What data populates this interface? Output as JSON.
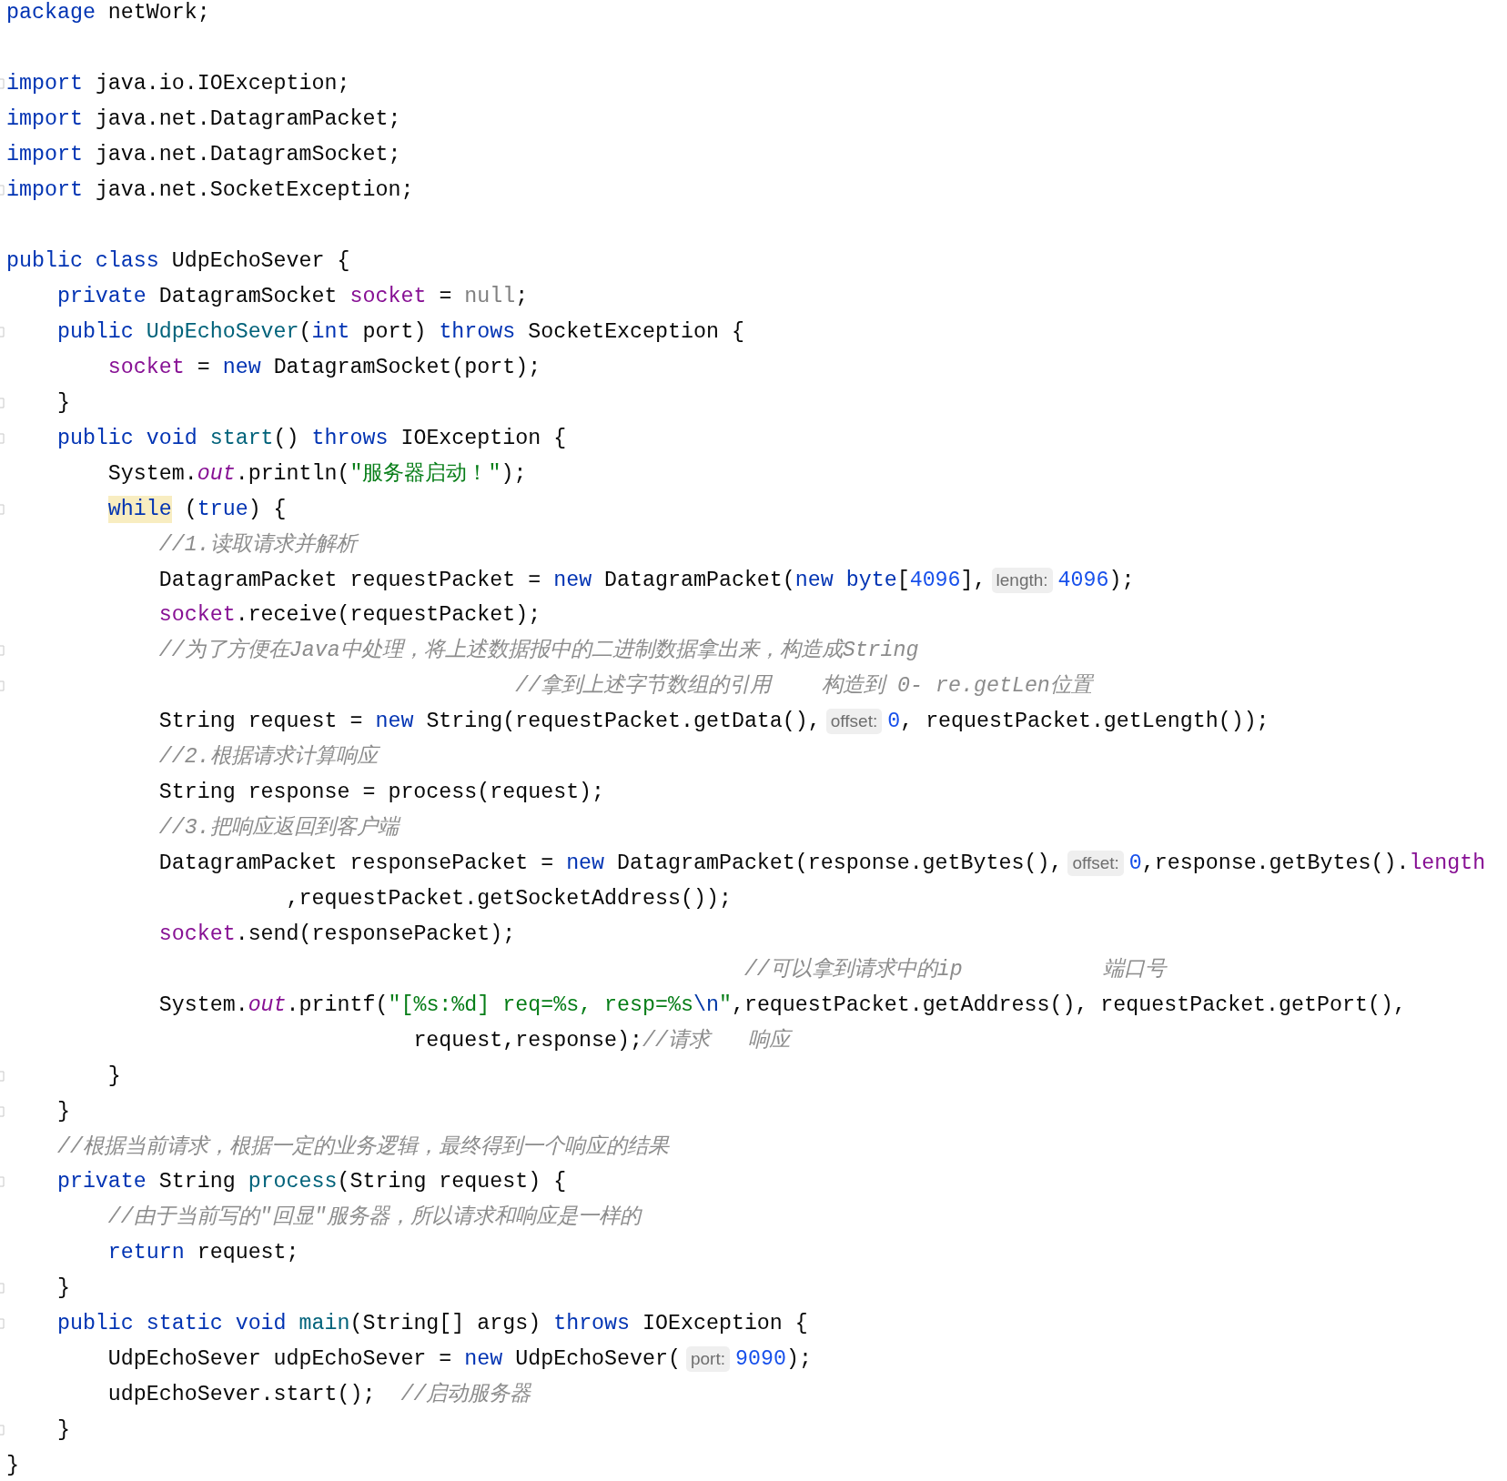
{
  "editor": {
    "lines": [
      {
        "tokens": [
          {
            "kind": "kw",
            "text": "package"
          },
          {
            "kind": "plain",
            "text": " netWork;"
          }
        ]
      },
      {
        "blank_line_before": true,
        "fold": true,
        "tokens": [
          {
            "kind": "kw",
            "text": "import"
          },
          {
            "kind": "plain",
            "text": " java.io.IOException;"
          }
        ]
      },
      {
        "tokens": [
          {
            "kind": "kw",
            "text": "import"
          },
          {
            "kind": "plain",
            "text": " java.net.DatagramPacket;"
          }
        ]
      },
      {
        "tokens": [
          {
            "kind": "kw",
            "text": "import"
          },
          {
            "kind": "plain",
            "text": " java.net.DatagramSocket;"
          }
        ]
      },
      {
        "fold": true,
        "tokens": [
          {
            "kind": "kw",
            "text": "import"
          },
          {
            "kind": "plain",
            "text": " java.net.SocketException;"
          }
        ]
      },
      {
        "blank_line_before": true,
        "tokens": [
          {
            "kind": "kw",
            "text": "public class"
          },
          {
            "kind": "plain",
            "text": " UdpEchoSever {"
          }
        ]
      },
      {
        "tokens": [
          {
            "kind": "kw",
            "text": "    private"
          },
          {
            "kind": "plain",
            "text": " DatagramSocket "
          },
          {
            "kind": "field",
            "text": "socket"
          },
          {
            "kind": "plain",
            "text": " = "
          },
          {
            "kind": "null",
            "text": "null"
          },
          {
            "kind": "plain",
            "text": ";"
          }
        ]
      },
      {
        "fold": true,
        "tokens": [
          {
            "kind": "kw",
            "text": "    public "
          },
          {
            "kind": "decl",
            "text": "UdpEchoSever"
          },
          {
            "kind": "plain",
            "text": "("
          },
          {
            "kind": "kw",
            "text": "int"
          },
          {
            "kind": "plain",
            "text": " port) "
          },
          {
            "kind": "kw",
            "text": "throws"
          },
          {
            "kind": "plain",
            "text": " SocketException {"
          }
        ]
      },
      {
        "tokens": [
          {
            "kind": "field",
            "text": "        socket"
          },
          {
            "kind": "plain",
            "text": " = "
          },
          {
            "kind": "kw",
            "text": "new"
          },
          {
            "kind": "plain",
            "text": " DatagramSocket(port);"
          }
        ]
      },
      {
        "fold": true,
        "tokens": [
          {
            "kind": "plain",
            "text": "    }"
          }
        ]
      },
      {
        "fold": true,
        "tokens": [
          {
            "kind": "kw",
            "text": "    public void "
          },
          {
            "kind": "decl",
            "text": "start"
          },
          {
            "kind": "plain",
            "text": "() "
          },
          {
            "kind": "kw",
            "text": "throws"
          },
          {
            "kind": "plain",
            "text": " IOException {"
          }
        ]
      },
      {
        "tokens": [
          {
            "kind": "plain",
            "text": "        System."
          },
          {
            "kind": "static",
            "text": "out"
          },
          {
            "kind": "plain",
            "text": ".println("
          },
          {
            "kind": "str",
            "text": "\"服务器启动！\""
          },
          {
            "kind": "plain",
            "text": ");"
          }
        ]
      },
      {
        "fold": true,
        "tokens": [
          {
            "kind": "highlight",
            "text": "        while"
          },
          {
            "kind": "plain",
            "text": " ("
          },
          {
            "kind": "kw",
            "text": "true"
          },
          {
            "kind": "plain",
            "text": ") {"
          }
        ]
      },
      {
        "tokens": [
          {
            "kind": "comment",
            "text": "            //1.读取请求并解析"
          }
        ]
      },
      {
        "tokens": [
          {
            "kind": "plain",
            "text": "            DatagramPacket requestPacket = "
          },
          {
            "kind": "kw",
            "text": "new"
          },
          {
            "kind": "plain",
            "text": " DatagramPacket("
          },
          {
            "kind": "kw",
            "text": "new byte"
          },
          {
            "kind": "plain",
            "text": "["
          },
          {
            "kind": "num",
            "text": "4096"
          },
          {
            "kind": "plain",
            "text": "],"
          },
          {
            "kind": "hint",
            "text": "length:"
          },
          {
            "kind": "num",
            "text": "4096"
          },
          {
            "kind": "plain",
            "text": ");"
          }
        ]
      },
      {
        "tokens": [
          {
            "kind": "field",
            "text": "            socket"
          },
          {
            "kind": "plain",
            "text": ".receive(requestPacket);"
          }
        ]
      },
      {
        "fold": true,
        "tokens": [
          {
            "kind": "comment",
            "text": "            //为了方便在Java中处理，将上述数据报中的二进制数据拿出来，构造成String"
          }
        ]
      },
      {
        "fold": true,
        "tokens": [
          {
            "kind": "comment",
            "text": "                                        //拿到上述字节数组的引用    构造到 0- re.getLen位置"
          }
        ]
      },
      {
        "tokens": [
          {
            "kind": "plain",
            "text": "            String request = "
          },
          {
            "kind": "kw",
            "text": "new"
          },
          {
            "kind": "plain",
            "text": " String(requestPacket.getData(),"
          },
          {
            "kind": "hint",
            "text": "offset:"
          },
          {
            "kind": "num",
            "text": "0"
          },
          {
            "kind": "plain",
            "text": ", requestPacket.getLength());"
          }
        ]
      },
      {
        "tokens": [
          {
            "kind": "comment",
            "text": "            //2.根据请求计算响应"
          }
        ]
      },
      {
        "tokens": [
          {
            "kind": "plain",
            "text": "            String response = process(request);"
          }
        ]
      },
      {
        "tokens": [
          {
            "kind": "comment",
            "text": "            //3.把响应返回到客户端"
          }
        ]
      },
      {
        "tokens": [
          {
            "kind": "plain",
            "text": "            DatagramPacket responsePacket = "
          },
          {
            "kind": "kw",
            "text": "new"
          },
          {
            "kind": "plain",
            "text": " DatagramPacket(response.getBytes(),"
          },
          {
            "kind": "hint",
            "text": "offset:"
          },
          {
            "kind": "num",
            "text": "0"
          },
          {
            "kind": "plain",
            "text": ",response.getBytes()."
          },
          {
            "kind": "field",
            "text": "length"
          }
        ]
      },
      {
        "tokens": [
          {
            "kind": "plain",
            "text": "                      ,requestPacket.getSocketAddress());"
          }
        ]
      },
      {
        "tokens": [
          {
            "kind": "field",
            "text": "            socket"
          },
          {
            "kind": "plain",
            "text": ".send(responsePacket);"
          }
        ]
      },
      {
        "tokens": [
          {
            "kind": "comment",
            "text": "                                                          //可以拿到请求中的ip           端口号"
          }
        ]
      },
      {
        "tokens": [
          {
            "kind": "plain",
            "text": "            System."
          },
          {
            "kind": "static",
            "text": "out"
          },
          {
            "kind": "plain",
            "text": ".printf("
          },
          {
            "kind": "str",
            "text": "\"[%s:%d] req=%s, resp=%s"
          },
          {
            "kind": "escape",
            "text": "\\n"
          },
          {
            "kind": "str",
            "text": "\""
          },
          {
            "kind": "plain",
            "text": ",requestPacket.getAddress(), requestPacket.getPort(),"
          }
        ]
      },
      {
        "tokens": [
          {
            "kind": "plain",
            "text": "                                request,response);"
          },
          {
            "kind": "comment",
            "text": "//请求   响应"
          }
        ]
      },
      {
        "fold": true,
        "tokens": [
          {
            "kind": "plain",
            "text": "        }"
          }
        ]
      },
      {
        "fold": true,
        "tokens": [
          {
            "kind": "plain",
            "text": "    }"
          }
        ]
      },
      {
        "tokens": [
          {
            "kind": "comment",
            "text": "    //根据当前请求，根据一定的业务逻辑，最终得到一个响应的结果"
          }
        ]
      },
      {
        "fold": true,
        "tokens": [
          {
            "kind": "kw",
            "text": "    private"
          },
          {
            "kind": "plain",
            "text": " String "
          },
          {
            "kind": "decl",
            "text": "process"
          },
          {
            "kind": "plain",
            "text": "(String request) {"
          }
        ]
      },
      {
        "tokens": [
          {
            "kind": "comment",
            "text": "        //由于当前写的\"回显\"服务器，所以请求和响应是一样的"
          }
        ]
      },
      {
        "tokens": [
          {
            "kind": "kw",
            "text": "        return"
          },
          {
            "kind": "plain",
            "text": " request;"
          }
        ]
      },
      {
        "fold": true,
        "tokens": [
          {
            "kind": "plain",
            "text": "    }"
          }
        ]
      },
      {
        "fold": true,
        "tokens": [
          {
            "kind": "kw",
            "text": "    public static void "
          },
          {
            "kind": "decl",
            "text": "main"
          },
          {
            "kind": "plain",
            "text": "(String[] args) "
          },
          {
            "kind": "kw",
            "text": "throws"
          },
          {
            "kind": "plain",
            "text": " IOException {"
          }
        ]
      },
      {
        "tokens": [
          {
            "kind": "plain",
            "text": "        UdpEchoSever udpEchoSever = "
          },
          {
            "kind": "kw",
            "text": "new"
          },
          {
            "kind": "plain",
            "text": " UdpEchoSever("
          },
          {
            "kind": "hint",
            "text": "port:"
          },
          {
            "kind": "num",
            "text": "9090"
          },
          {
            "kind": "plain",
            "text": ");"
          }
        ]
      },
      {
        "tokens": [
          {
            "kind": "plain",
            "text": "        udpEchoSever.start();  "
          },
          {
            "kind": "comment",
            "text": "//启动服务器"
          }
        ]
      },
      {
        "fold": true,
        "tokens": [
          {
            "kind": "plain",
            "text": "    }"
          }
        ]
      },
      {
        "tokens": [
          {
            "kind": "plain",
            "text": "}"
          }
        ]
      }
    ]
  }
}
